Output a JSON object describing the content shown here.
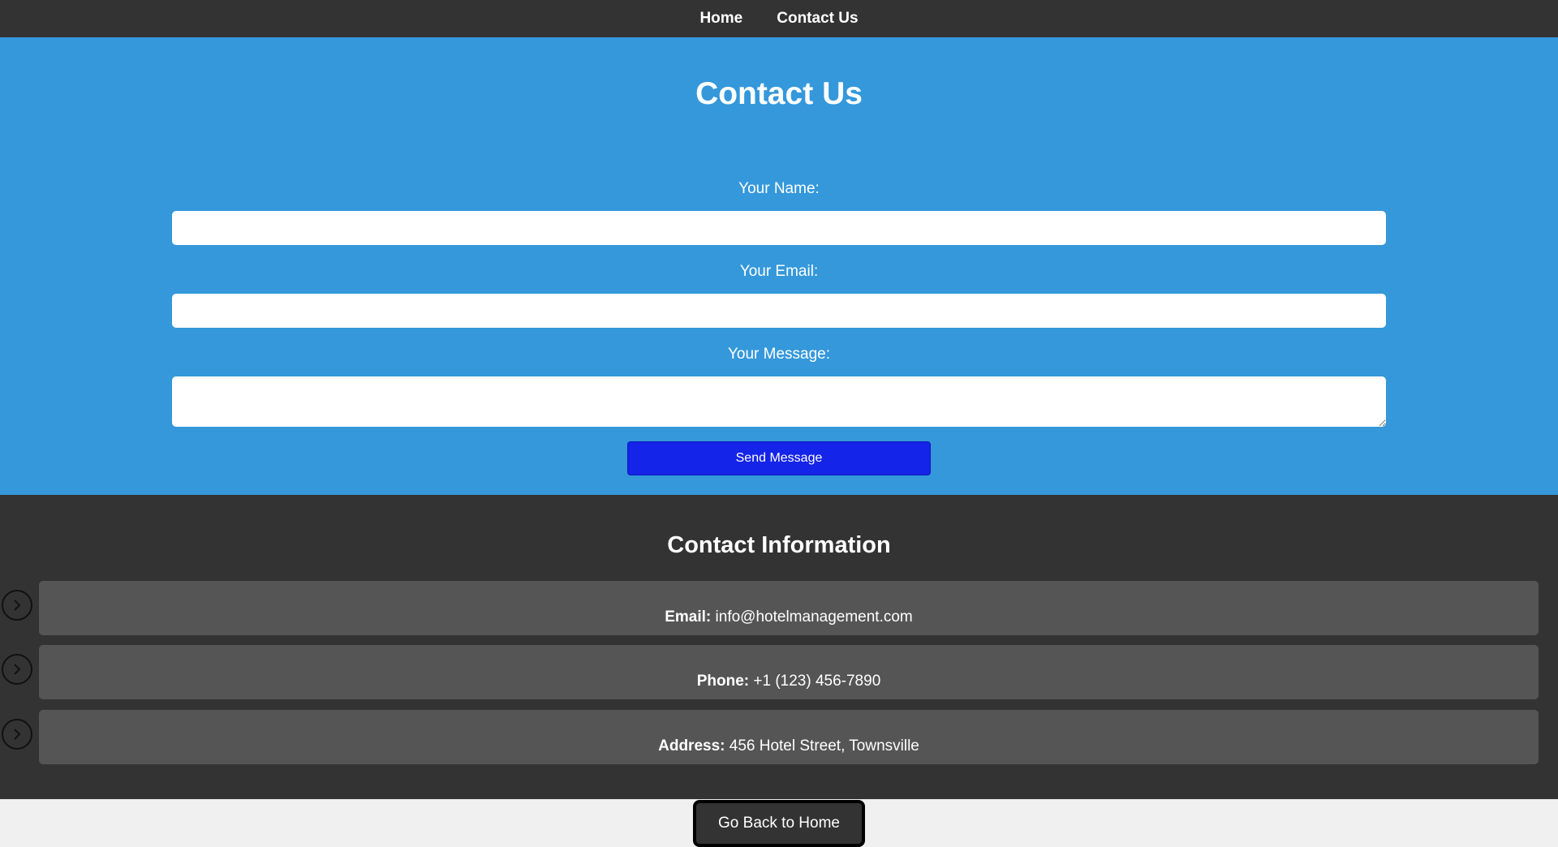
{
  "nav": {
    "items": [
      {
        "label": "Home"
      },
      {
        "label": "Contact Us"
      }
    ]
  },
  "contact_form": {
    "title": "Contact Us",
    "name_label": "Your Name:",
    "name_value": "",
    "email_label": "Your Email:",
    "email_value": "",
    "message_label": "Your Message:",
    "message_value": "",
    "submit_label": "Send Message"
  },
  "contact_info": {
    "title": "Contact Information",
    "rows": [
      {
        "key": "Email:",
        "value": "info@hotelmanagement.com",
        "icon": "chevron-right-icon"
      },
      {
        "key": "Phone:",
        "value": "+1 (123) 456-7890",
        "icon": "chevron-right-icon"
      },
      {
        "key": "Address:",
        "value": "456 Hotel Street, Townsville",
        "icon": "chevron-right-icon"
      }
    ]
  },
  "footer": {
    "back_label": "Go Back to Home"
  },
  "colors": {
    "nav_bg": "#333333",
    "form_bg": "#3498db",
    "submit_bg": "#1424e8",
    "info_bg": "#333333",
    "info_row_bg": "#555555",
    "page_bg": "#f0f0f0"
  }
}
